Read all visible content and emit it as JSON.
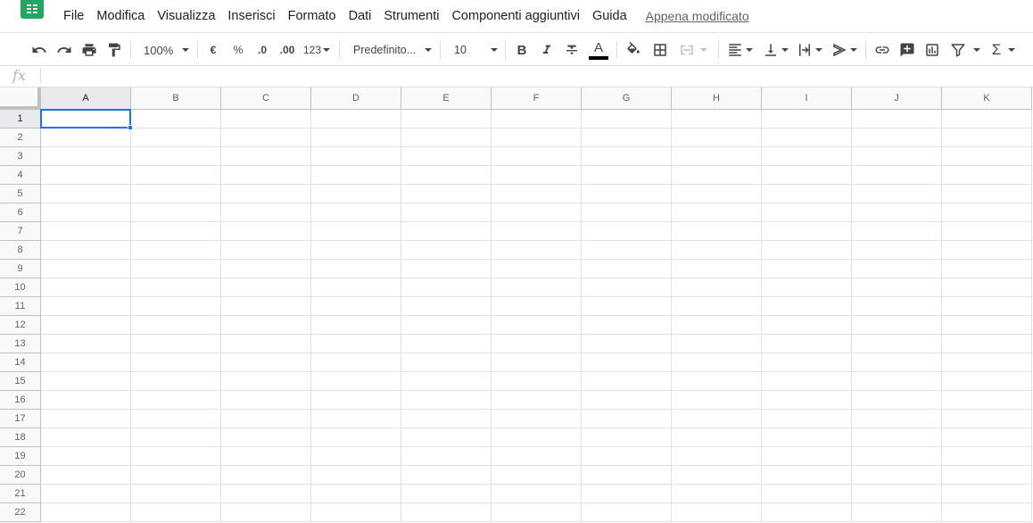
{
  "menubar": {
    "items": [
      "File",
      "Modifica",
      "Visualizza",
      "Inserisci",
      "Formato",
      "Dati",
      "Strumenti",
      "Componenti aggiuntivi",
      "Guida"
    ],
    "last_edit": "Appena modificato"
  },
  "toolbar": {
    "zoom": "100%",
    "currency": "€",
    "percent": "%",
    "decrease_decimals": ".0",
    "increase_decimals": ".00",
    "more_formats": "123",
    "font": "Predefinito...",
    "font_size": "10",
    "bold": "B",
    "text_color_letter": "A",
    "functions": "Σ"
  },
  "formula_bar": {
    "label": "fx"
  },
  "grid": {
    "columns": [
      "A",
      "B",
      "C",
      "D",
      "E",
      "F",
      "G",
      "H",
      "I",
      "J",
      "K"
    ],
    "rows": [
      "1",
      "2",
      "3",
      "4",
      "5",
      "6",
      "7",
      "8",
      "9",
      "10",
      "11",
      "12",
      "13",
      "14",
      "15",
      "16",
      "17",
      "18",
      "19",
      "20",
      "21",
      "22"
    ],
    "active_cell": "A1"
  },
  "colors": {
    "sheets_green": "#23a566",
    "selection_blue": "#1a73e8",
    "icon_gray": "#444444"
  }
}
